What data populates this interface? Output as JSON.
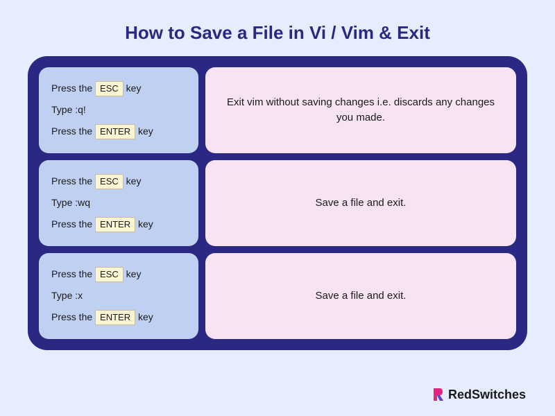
{
  "title": "How to Save a File in Vi / Vim & Exit",
  "rows": [
    {
      "press1a": "Press the ",
      "key1": "ESC",
      "press1b": " key",
      "type": "Type :q!",
      "press2a": "Press the ",
      "key2": "ENTER",
      "press2b": " key",
      "desc": "Exit vim without saving changes i.e. discards any changes you made."
    },
    {
      "press1a": "Press the ",
      "key1": "ESC",
      "press1b": " key",
      "type": "Type :wq",
      "press2a": "Press the ",
      "key2": "ENTER",
      "press2b": " key",
      "desc": "Save a file and exit."
    },
    {
      "press1a": "Press the ",
      "key1": "ESC",
      "press1b": " key",
      "type": "Type :x",
      "press2a": "Press the ",
      "key2": "ENTER",
      "press2b": " key",
      "desc": "Save a file and exit."
    }
  ],
  "brand": "RedSwitches"
}
